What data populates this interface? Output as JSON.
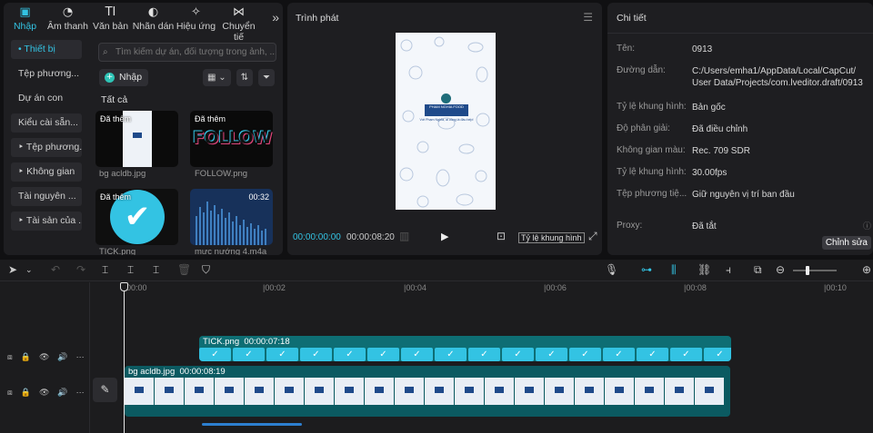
{
  "left_panel": {
    "tabs": [
      {
        "label": "Nhập",
        "icon": "import-icon",
        "glyph": "▣",
        "active": true
      },
      {
        "label": "Âm thanh",
        "icon": "audio-icon",
        "glyph": "◔",
        "active": false
      },
      {
        "label": "Văn bản",
        "icon": "text-icon",
        "glyph": "TI",
        "active": false
      },
      {
        "label": "Nhãn dán",
        "icon": "sticker-icon",
        "glyph": "◐",
        "active": false
      },
      {
        "label": "Hiệu ứng",
        "icon": "effects-icon",
        "glyph": "✧",
        "active": false
      },
      {
        "label": "Chuyển tiế",
        "icon": "transition-icon",
        "glyph": "⋈",
        "active": false
      }
    ],
    "more_glyph": "»",
    "sidebar": [
      {
        "label": "• Thiết bị",
        "style": "active"
      },
      {
        "label": "Tệp phương...",
        "style": "plain"
      },
      {
        "label": "Dự án con",
        "style": "plain"
      },
      {
        "label": "Kiểu cài sẵn...",
        "style": "box"
      },
      {
        "label": "‣ Tệp phương...",
        "style": "box"
      },
      {
        "label": "‣ Không gian",
        "style": "box"
      },
      {
        "label": "Tài nguyên ...",
        "style": "box"
      },
      {
        "label": "‣ Tài sản của ...",
        "style": "box"
      }
    ],
    "search_placeholder": "Tìm kiếm dự án, đối tượng trong ảnh, ...",
    "import_label": "Nhập",
    "view_buttons": [
      "▦ ⌄",
      "⇅",
      "⏷"
    ],
    "section_title": "Tất cả",
    "media": [
      {
        "badge": "Đã thêm",
        "name": "bg acldb.jpg",
        "duration": ""
      },
      {
        "badge": "Đã thêm",
        "name": "FOLLOW.png",
        "duration": ""
      },
      {
        "badge": "Đã thêm",
        "name": "TICK.png",
        "duration": ""
      },
      {
        "badge": "",
        "name": "mưc nướng 4.m4a",
        "duration": "00:32"
      }
    ],
    "follow_text": "FOLLOW"
  },
  "player": {
    "title": "Trình phát",
    "current_time": "00:00:00:00",
    "total_time": "00:00:08:20",
    "ratio_label": "Tỷ lệ khung hình",
    "logo_text": "PHAM NGHIA FOOD",
    "tagline": "Với Phạm Nghĩa, ai cũng là đầu bếp!"
  },
  "details": {
    "title": "Chi tiết",
    "rows": [
      {
        "label": "Tên:",
        "value": "0913"
      },
      {
        "label": "Đường dẫn:",
        "value": "C:/Users/emha1/AppData/Local/CapCut/ User Data/Projects/com.lveditor.draft/0913"
      },
      {
        "label": "Tỷ lệ khung hình:",
        "value": "Bản gốc"
      },
      {
        "label": "Độ phân giải:",
        "value": "Đã điều chỉnh"
      },
      {
        "label": "Không gian màu:",
        "value": "Rec. 709 SDR"
      },
      {
        "label": "Tỷ lệ khung hình:",
        "value": "30.00fps"
      },
      {
        "label": "Tệp phương tiệ...",
        "value": "Giữ nguyên vị trí ban đầu"
      },
      {
        "label": "Proxy:",
        "value": "Đã tắt"
      }
    ],
    "edit_button": "Chỉnh sửa"
  },
  "timeline": {
    "ruler": [
      "00:00",
      "|00:02",
      "|00:04",
      "|00:06",
      "|00:08",
      "|00:10"
    ],
    "tracks": [
      {
        "clip_name": "TICK.png",
        "clip_duration": "00:00:07:18"
      },
      {
        "clip_name": "bg acldb.jpg",
        "clip_duration": "00:00:08:19"
      }
    ],
    "colors": {
      "accent": "#33c3e3",
      "sticker_track": "#0e6e74",
      "main_track": "#0b5a61"
    }
  }
}
